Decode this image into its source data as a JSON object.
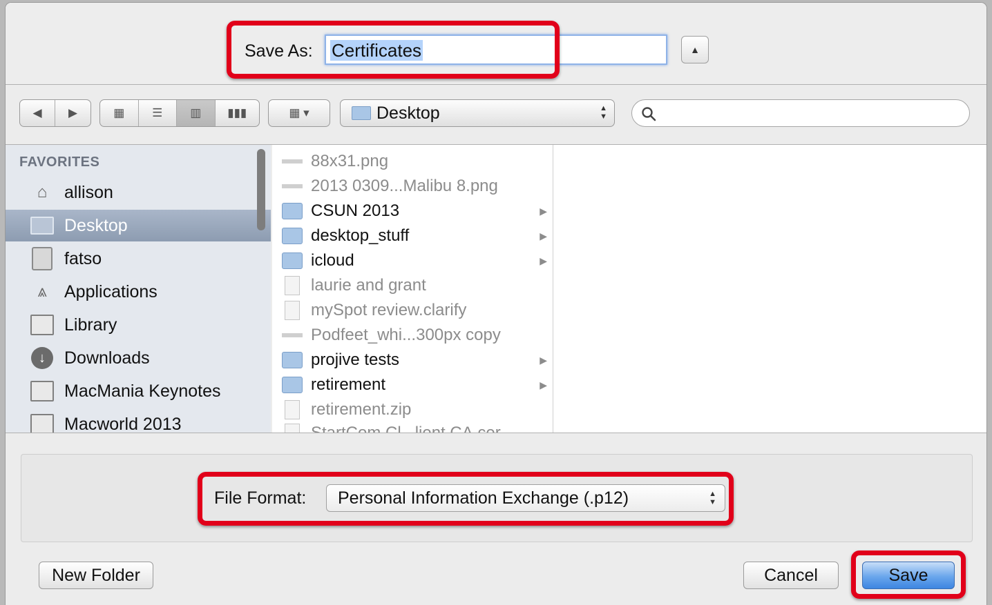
{
  "save_as": {
    "label": "Save As:",
    "value": "Certificates",
    "expand_icon": "triangle-up-icon"
  },
  "toolbar": {
    "back_icon": "back-arrow-icon",
    "forward_icon": "forward-arrow-icon",
    "view_modes": [
      "icon-view",
      "list-view",
      "column-view",
      "coverflow-view"
    ],
    "active_view": "column-view",
    "arrange_icon": "arrange-grid-icon",
    "location": "Desktop"
  },
  "sidebar": {
    "header": "FAVORITES",
    "items": [
      {
        "label": "allison",
        "icon": "home-icon"
      },
      {
        "label": "Desktop",
        "icon": "desktop-icon",
        "selected": true
      },
      {
        "label": "fatso",
        "icon": "hard-drive-icon"
      },
      {
        "label": "Applications",
        "icon": "applications-icon"
      },
      {
        "label": "Library",
        "icon": "folder-icon"
      },
      {
        "label": "Downloads",
        "icon": "downloads-icon"
      },
      {
        "label": "MacMania Keynotes",
        "icon": "folder-icon"
      },
      {
        "label": "Macworld 2013",
        "icon": "folder-icon"
      }
    ]
  },
  "files": [
    {
      "name": "88x31.png",
      "kind": "image",
      "enabled": false
    },
    {
      "name": "2013 0309...Malibu 8.png",
      "kind": "image",
      "enabled": false
    },
    {
      "name": "CSUN 2013",
      "kind": "folder",
      "enabled": true
    },
    {
      "name": "desktop_stuff",
      "kind": "folder",
      "enabled": true
    },
    {
      "name": "icloud",
      "kind": "folder",
      "enabled": true
    },
    {
      "name": "laurie and grant",
      "kind": "file",
      "enabled": false
    },
    {
      "name": "mySpot review.clarify",
      "kind": "file",
      "enabled": false
    },
    {
      "name": "Podfeet_whi...300px copy",
      "kind": "image",
      "enabled": false
    },
    {
      "name": "projive tests",
      "kind": "folder",
      "enabled": true
    },
    {
      "name": "retirement",
      "kind": "folder",
      "enabled": true
    },
    {
      "name": "retirement.zip",
      "kind": "file",
      "enabled": false
    },
    {
      "name": "StartCom Cl...lient CA.cer",
      "kind": "file",
      "enabled": false
    }
  ],
  "format": {
    "label": "File Format:",
    "value": "Personal Information Exchange (.p12)"
  },
  "buttons": {
    "new_folder": "New Folder",
    "cancel": "Cancel",
    "save": "Save"
  },
  "colors": {
    "highlight_red": "#e1001a",
    "selection_blue": "#b4d3fb",
    "primary_button": "#3d86e1"
  }
}
